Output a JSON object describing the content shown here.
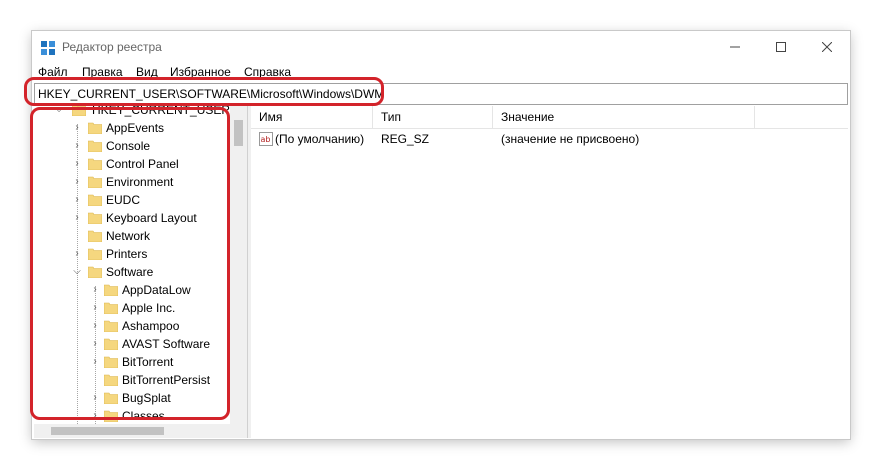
{
  "window": {
    "title": "Редактор реестра"
  },
  "menu": [
    "Файл",
    "Правка",
    "Вид",
    "Избранное",
    "Справка"
  ],
  "address": "HKEY_CURRENT_USER\\SOFTWARE\\Microsoft\\Windows\\DWM",
  "tree": {
    "root": "HKEY_CURRENT_USER",
    "items": [
      "AppEvents",
      "Console",
      "Control Panel",
      "Environment",
      "EUDC",
      "Keyboard Layout",
      "Network",
      "Printers",
      "Software"
    ],
    "software_children": [
      "AppDataLow",
      "Apple Inc.",
      "Ashampoo",
      "AVAST Software",
      "BitTorrent",
      "BitTorrentPersist",
      "BugSplat",
      "Classes"
    ]
  },
  "list": {
    "columns": [
      "Имя",
      "Тип",
      "Значение"
    ],
    "rows": [
      {
        "name": "(По умолчанию)",
        "type": "REG_SZ",
        "value": "(значение не присвоено)"
      }
    ]
  },
  "colors": {
    "highlight": "#d3232a",
    "folder": "#f5d77f",
    "accent": "#0078d7"
  }
}
